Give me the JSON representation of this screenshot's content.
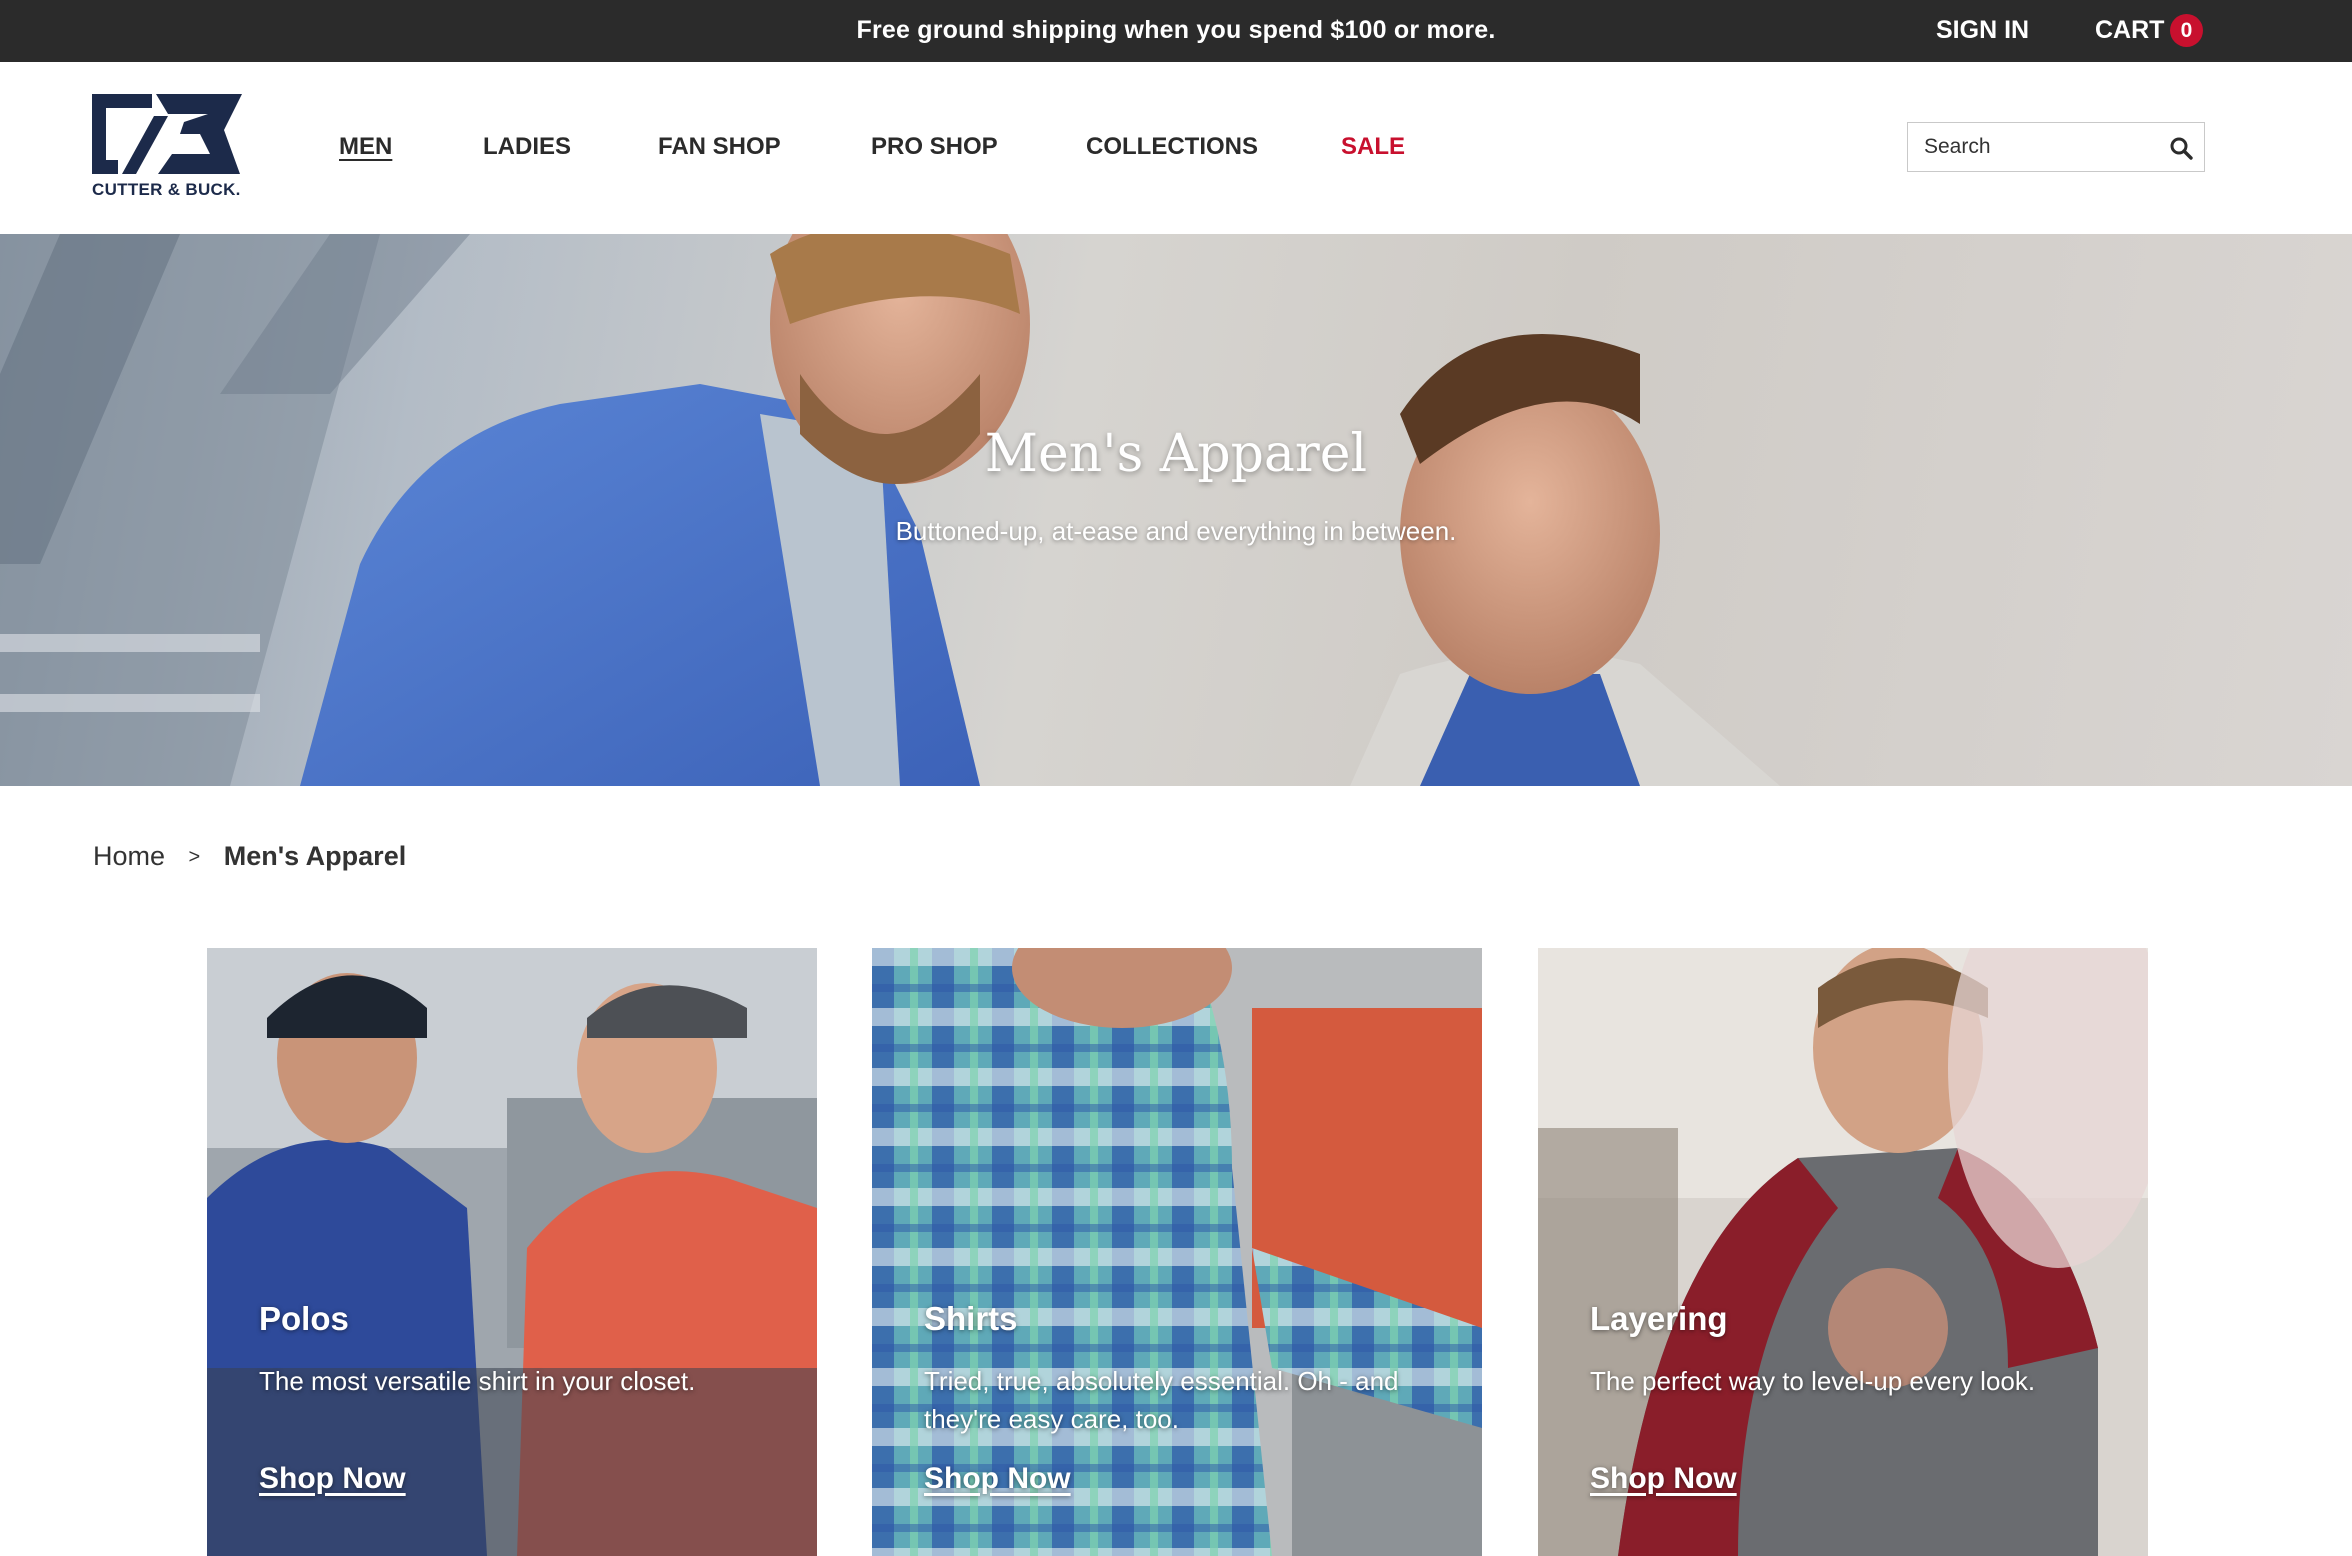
{
  "promo": {
    "text": "Free ground shipping when you spend $100 or more.",
    "sign_in": "SIGN IN",
    "cart_label": "CART",
    "cart_count": "0"
  },
  "brand": {
    "name": "CUTTER & BUCK.",
    "navy": "#1c2a4a"
  },
  "nav": {
    "items": [
      {
        "label": "MEN"
      },
      {
        "label": "LADIES"
      },
      {
        "label": "FAN SHOP"
      },
      {
        "label": "PRO SHOP"
      },
      {
        "label": "COLLECTIONS"
      },
      {
        "label": "SALE"
      }
    ],
    "active": "MEN",
    "sale_color": "#c8102e"
  },
  "search": {
    "placeholder": "Search",
    "value": ""
  },
  "hero": {
    "title": "Men's Apparel",
    "subtitle": "Buttoned-up, at-ease and everything in between."
  },
  "breadcrumb": {
    "home": "Home",
    "separator": ">",
    "current": "Men's Apparel"
  },
  "categories": [
    {
      "title": "Polos",
      "description": "The most versatile shirt in your closet.",
      "link": "Shop Now"
    },
    {
      "title": "Shirts",
      "description": "Tried, true, absolutely essential. Oh - and they're easy care, too.",
      "link": "Shop Now"
    },
    {
      "title": "Layering",
      "description": "The perfect way to level-up every look.",
      "link": "Shop Now"
    }
  ]
}
